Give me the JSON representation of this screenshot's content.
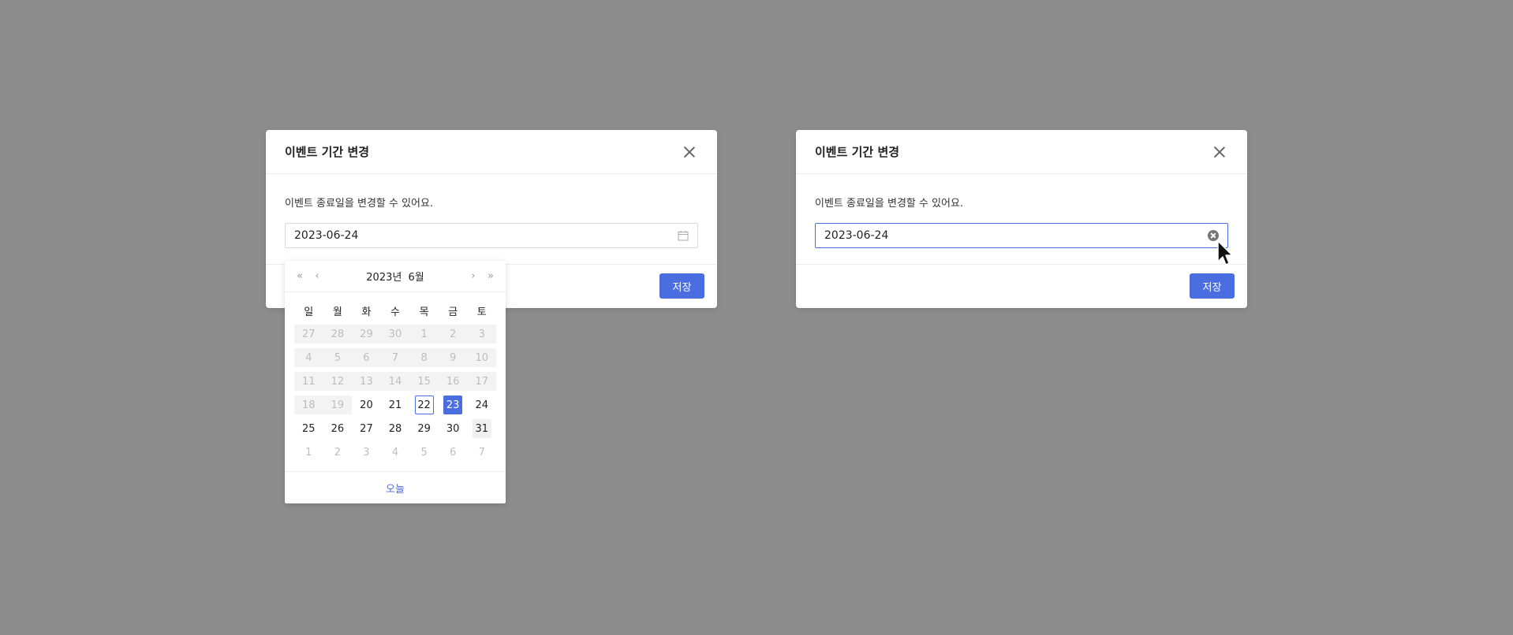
{
  "left_modal": {
    "title": "이벤트 기간 변경",
    "description": "이벤트 종료일을 변경할 수 있어요.",
    "date_value": "2023-06-24",
    "save_label": "저장"
  },
  "right_modal": {
    "title": "이벤트 기간 변경",
    "description": "이벤트 종료일을 변경할 수 있어요.",
    "date_value": "2023-06-24",
    "save_label": "저장"
  },
  "calendar": {
    "year_label": "2023년",
    "month_label": "6월",
    "prev_year": "«",
    "prev_month": "‹",
    "next_month": "›",
    "next_year": "»",
    "weekdays": [
      "일",
      "월",
      "화",
      "수",
      "목",
      "금",
      "토"
    ],
    "weeks": [
      [
        {
          "d": "27",
          "s": "disabled"
        },
        {
          "d": "28",
          "s": "disabled"
        },
        {
          "d": "29",
          "s": "disabled"
        },
        {
          "d": "30",
          "s": "disabled"
        },
        {
          "d": "1",
          "s": "disabled"
        },
        {
          "d": "2",
          "s": "disabled"
        },
        {
          "d": "3",
          "s": "disabled"
        }
      ],
      [
        {
          "d": "4",
          "s": "disabled"
        },
        {
          "d": "5",
          "s": "disabled"
        },
        {
          "d": "6",
          "s": "disabled"
        },
        {
          "d": "7",
          "s": "disabled"
        },
        {
          "d": "8",
          "s": "disabled"
        },
        {
          "d": "9",
          "s": "disabled"
        },
        {
          "d": "10",
          "s": "disabled"
        }
      ],
      [
        {
          "d": "11",
          "s": "disabled"
        },
        {
          "d": "12",
          "s": "disabled"
        },
        {
          "d": "13",
          "s": "disabled"
        },
        {
          "d": "14",
          "s": "disabled"
        },
        {
          "d": "15",
          "s": "disabled"
        },
        {
          "d": "16",
          "s": "disabled"
        },
        {
          "d": "17",
          "s": "disabled"
        }
      ],
      [
        {
          "d": "18",
          "s": "disabled"
        },
        {
          "d": "19",
          "s": "disabled"
        },
        {
          "d": "20",
          "s": ""
        },
        {
          "d": "21",
          "s": ""
        },
        {
          "d": "22",
          "s": "today"
        },
        {
          "d": "23",
          "s": "selected"
        },
        {
          "d": "24",
          "s": ""
        }
      ],
      [
        {
          "d": "25",
          "s": ""
        },
        {
          "d": "26",
          "s": ""
        },
        {
          "d": "27",
          "s": ""
        },
        {
          "d": "28",
          "s": ""
        },
        {
          "d": "29",
          "s": ""
        },
        {
          "d": "30",
          "s": ""
        },
        {
          "d": "31",
          "s": "hover"
        }
      ],
      [
        {
          "d": "1",
          "s": "outside"
        },
        {
          "d": "2",
          "s": "outside"
        },
        {
          "d": "3",
          "s": "outside"
        },
        {
          "d": "4",
          "s": "outside"
        },
        {
          "d": "5",
          "s": "outside"
        },
        {
          "d": "6",
          "s": "outside"
        },
        {
          "d": "7",
          "s": "outside"
        }
      ]
    ],
    "today_label": "오늘"
  },
  "colors": {
    "accent": "#4a6ee0",
    "backdrop": "#8d8d8d"
  },
  "icons": {
    "close": "close-icon",
    "calendar": "calendar-icon",
    "clear": "clear-icon",
    "cursor": "mouse-pointer-icon"
  }
}
